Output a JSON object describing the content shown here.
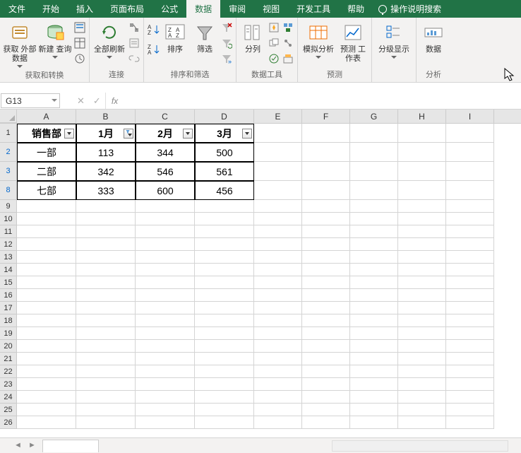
{
  "menubar": {
    "tabs": [
      "文件",
      "开始",
      "插入",
      "页面布局",
      "公式",
      "数据",
      "审阅",
      "视图",
      "开发工具",
      "帮助"
    ],
    "active_index": 5,
    "tell_me": "操作说明搜索"
  },
  "ribbon": {
    "groups": [
      {
        "label": "获取和转换",
        "buttons": [
          {
            "label": "获取\n外部数据",
            "with_caret": true
          },
          {
            "label": "新建\n查询",
            "with_caret": true
          }
        ]
      },
      {
        "label": "连接",
        "buttons": [
          {
            "label": "全部刷新",
            "with_caret": true
          }
        ]
      },
      {
        "label": "排序和筛选",
        "buttons": [
          {
            "label": "排序"
          },
          {
            "label": "筛选"
          }
        ]
      },
      {
        "label": "数据工具",
        "buttons": [
          {
            "label": "分列"
          }
        ]
      },
      {
        "label": "预测",
        "buttons": [
          {
            "label": "模拟分析",
            "with_caret": true
          },
          {
            "label": "预测\n工作表"
          }
        ]
      },
      {
        "label": "",
        "buttons": [
          {
            "label": "分级显示",
            "with_caret": true
          }
        ]
      },
      {
        "label": "分析",
        "buttons": [
          {
            "label": "数据"
          }
        ]
      }
    ]
  },
  "namebox": "G13",
  "formula": "",
  "columns": [
    "A",
    "B",
    "C",
    "D",
    "E",
    "F",
    "G",
    "H",
    "I"
  ],
  "col_widths": {
    "A": 84,
    "B": 84,
    "C": 84,
    "D": 84,
    "E": 68,
    "F": 68,
    "G": 68,
    "H": 68,
    "I": 68
  },
  "visible_rows": [
    1,
    2,
    3,
    8,
    9,
    10,
    11,
    12,
    13,
    14,
    15,
    16,
    17,
    18,
    19,
    20,
    21,
    22,
    23,
    24,
    25,
    26
  ],
  "filtered_rows": [
    2,
    3,
    8
  ],
  "table": {
    "headers": [
      "销售部",
      "1月",
      "2月",
      "3月"
    ],
    "filter_active_col": 1,
    "rows": [
      {
        "row_num": 2,
        "cells": [
          "一部",
          "113",
          "344",
          "500"
        ]
      },
      {
        "row_num": 3,
        "cells": [
          "二部",
          "342",
          "546",
          "561"
        ]
      },
      {
        "row_num": 8,
        "cells": [
          "七部",
          "333",
          "600",
          "456"
        ]
      }
    ]
  },
  "chart_data": {
    "type": "table",
    "title": "",
    "columns": [
      "销售部",
      "1月",
      "2月",
      "3月"
    ],
    "rows": [
      [
        "一部",
        113,
        344,
        500
      ],
      [
        "二部",
        342,
        546,
        561
      ],
      [
        "七部",
        333,
        600,
        456
      ]
    ]
  }
}
